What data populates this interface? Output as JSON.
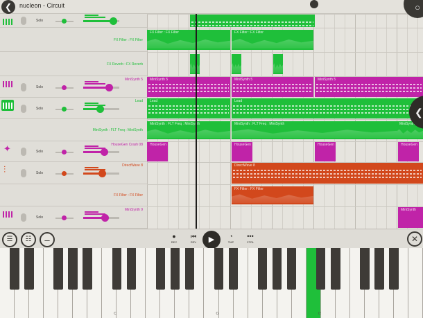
{
  "app": {
    "title": "nucleon - Circuit",
    "back_icon": "back-icon"
  },
  "colors": {
    "green": "#1fbf3a",
    "magenta": "#c023a8",
    "orange": "#d2481c",
    "red": "#c8373a",
    "dark": "#2e2c28"
  },
  "tracks": [
    {
      "id": "lead-top",
      "kind": "synth",
      "name": "",
      "color": "#1fbf3a",
      "solo": "Solo",
      "vol": 0.82,
      "icon": "keyboard-icon"
    },
    {
      "id": "fxfilter-g",
      "kind": "auto",
      "name": "FX Filter : FX Filter",
      "color": "#1fbf3a"
    },
    {
      "id": "fxreverb-g",
      "kind": "auto",
      "name": "FX Reverb : FX Reverb",
      "color": "#1fbf3a"
    },
    {
      "id": "minisynth5",
      "kind": "synth",
      "name": "MiniSynth 5",
      "color": "#c023a8",
      "solo": "Solo",
      "vol": 0.72,
      "icon": "keyboard-icon"
    },
    {
      "id": "lead",
      "kind": "synth",
      "name": "Lead",
      "color": "#1fbf3a",
      "solo": "Solo",
      "vol": 0.46,
      "icon": "keyboard-icon"
    },
    {
      "id": "minisynth-flt",
      "kind": "auto",
      "name": "MiniSynth : FLT Freq : MiniSynth",
      "color": "#1fbf3a"
    },
    {
      "id": "housegen",
      "kind": "synth",
      "name": "HouseGen Crash 08",
      "color": "#c023a8",
      "solo": "Solo",
      "vol": 0.58,
      "icon": "drum-icon"
    },
    {
      "id": "directwave",
      "kind": "synth",
      "name": "DirectWave 8",
      "color": "#d2481c",
      "solo": "Solo",
      "vol": 0.52,
      "icon": "waveform-icon"
    },
    {
      "id": "fxfilter-o",
      "kind": "auto",
      "name": "FX Filter : FX Filter",
      "color": "#d2481c"
    },
    {
      "id": "minisynth9",
      "kind": "synth",
      "name": "MiniSynth 9",
      "color": "#c023a8",
      "solo": "Solo",
      "vol": 0.6,
      "icon": "keyboard-icon"
    }
  ],
  "clips": [
    {
      "row": 0,
      "label": "",
      "color": "#1fbf3a",
      "start": 62,
      "len": 180
    },
    {
      "row": 1,
      "label": "FX Filter : FX Filter",
      "color": "#1fbf3a",
      "start": 0,
      "len": 120
    },
    {
      "row": 1,
      "label": "FX Filter : FX Filter",
      "color": "#1fbf3a",
      "start": 122,
      "len": 118
    },
    {
      "row": 2,
      "label": "",
      "color": "#1fbf3a",
      "start": 62,
      "len": 14
    },
    {
      "row": 2,
      "label": "",
      "color": "#1fbf3a",
      "start": 122,
      "len": 14
    },
    {
      "row": 2,
      "label": "",
      "color": "#1fbf3a",
      "start": 182,
      "len": 14
    },
    {
      "row": 3,
      "label": "MiniSynth 5",
      "color": "#c023a8",
      "start": 0,
      "len": 120
    },
    {
      "row": 3,
      "label": "MiniSynth 5",
      "color": "#c023a8",
      "start": 122,
      "len": 118
    },
    {
      "row": 3,
      "label": "MiniSynth 5",
      "color": "#c023a8",
      "start": 242,
      "len": 156
    },
    {
      "row": 4,
      "label": "Lead",
      "color": "#1fbf3a",
      "start": 0,
      "len": 120
    },
    {
      "row": 4,
      "label": "Lead",
      "color": "#1fbf3a",
      "start": 122,
      "len": 276
    },
    {
      "row": 5,
      "label": "MiniSynth : FLT Freq : MiniSynth",
      "color": "#1fbf3a",
      "start": 0,
      "len": 120
    },
    {
      "row": 5,
      "label": "MiniSynth : FLT Freq : MiniSynth",
      "color": "#1fbf3a",
      "start": 122,
      "len": 238
    },
    {
      "row": 5,
      "label": "MiniSynth",
      "color": "#1fbf3a",
      "start": 360,
      "len": 38
    },
    {
      "row": 6,
      "label": "HouseGen",
      "color": "#c023a8",
      "start": 0,
      "len": 30
    },
    {
      "row": 6,
      "label": "HouseGen",
      "color": "#c023a8",
      "start": 122,
      "len": 30
    },
    {
      "row": 6,
      "label": "HouseGen",
      "color": "#c023a8",
      "start": 242,
      "len": 30
    },
    {
      "row": 6,
      "label": "HouseGen",
      "color": "#c023a8",
      "start": 362,
      "len": 30
    },
    {
      "row": 7,
      "label": "DirectWave 8",
      "color": "#d2481c",
      "start": 122,
      "len": 276
    },
    {
      "row": 8,
      "label": "FX Filter : FX Filter",
      "color": "#d2481c",
      "start": 122,
      "len": 118
    },
    {
      "row": 9,
      "label": "MiniSynth",
      "color": "#c023a8",
      "start": 362,
      "len": 36
    }
  ],
  "transport": {
    "buttons": [
      {
        "label": "REC",
        "glyph": "●"
      },
      {
        "label": "REV",
        "glyph": "⏮"
      },
      {
        "label": "TMP",
        "glyph": "◔"
      },
      {
        "label": "CTRL",
        "glyph": "•••"
      }
    ],
    "play_glyph": "▶",
    "close_glyph": "✕",
    "left_icons": [
      "mixer-icon",
      "eq-icon",
      "menu-icon"
    ]
  },
  "keyboard": {
    "labels": [
      "C3",
      "C4",
      "C5"
    ],
    "active_key": "C5"
  }
}
